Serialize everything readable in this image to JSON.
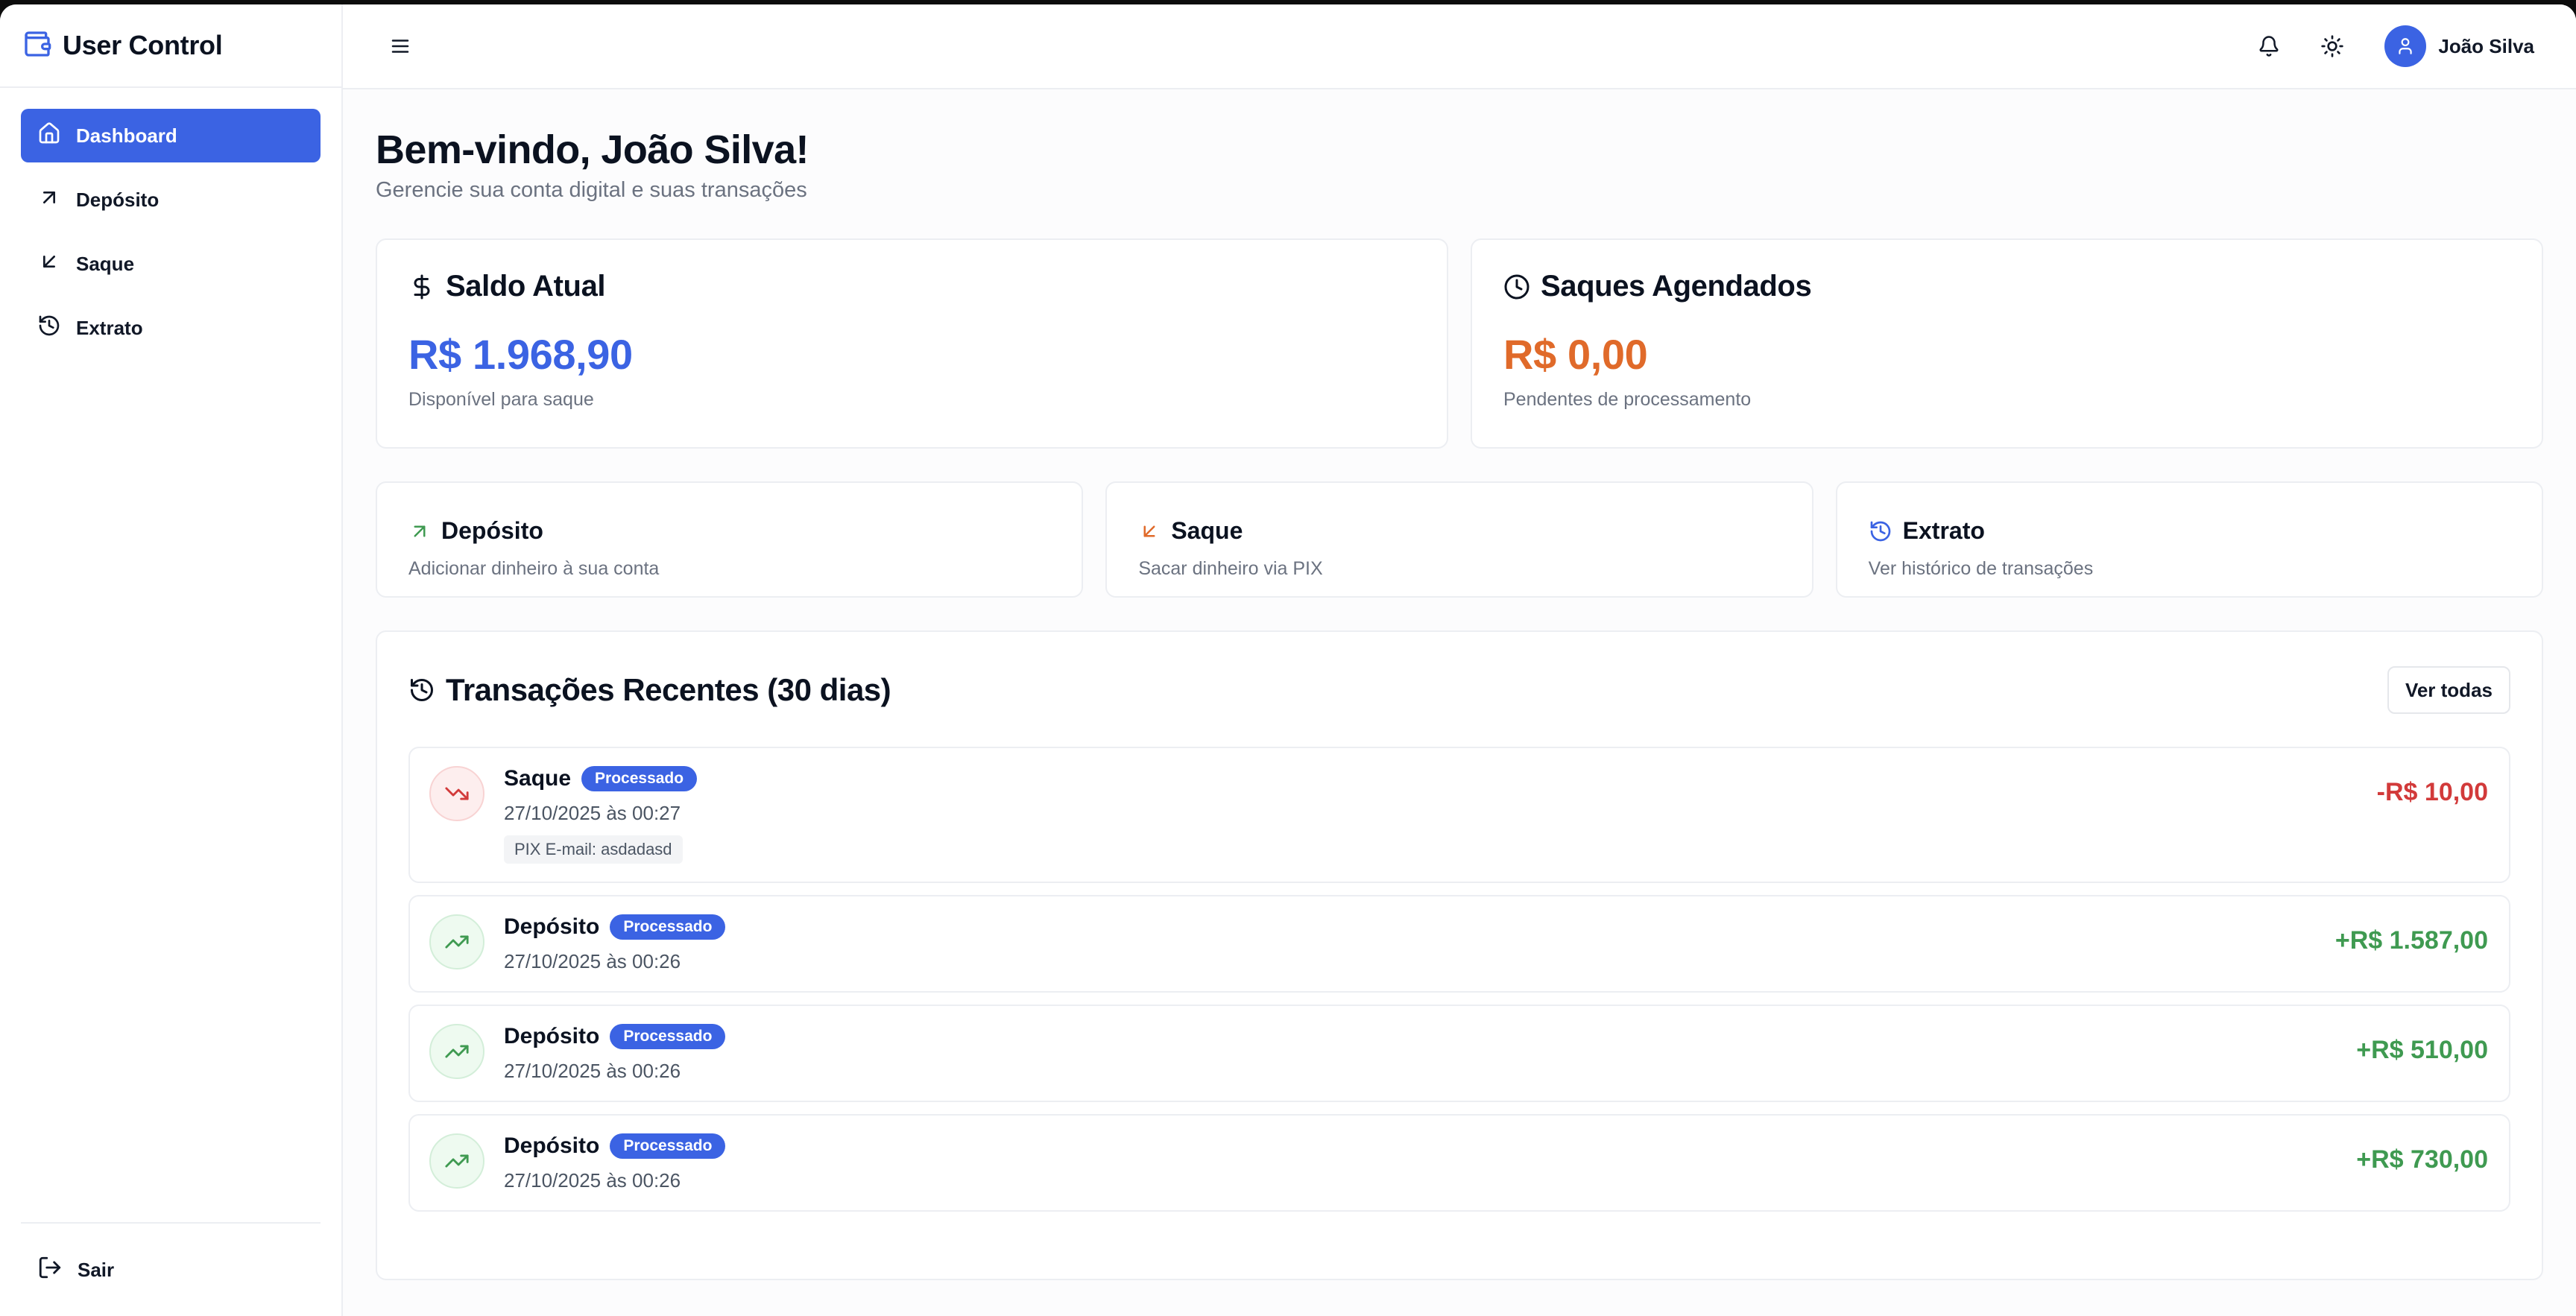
{
  "app": {
    "title": "User Control"
  },
  "sidebar": {
    "items": [
      {
        "label": "Dashboard",
        "icon": "home-icon",
        "active": true
      },
      {
        "label": "Depósito",
        "icon": "arrow-up-right-icon"
      },
      {
        "label": "Saque",
        "icon": "arrow-down-left-icon"
      },
      {
        "label": "Extrato",
        "icon": "history-icon"
      }
    ],
    "logout_label": "Sair"
  },
  "topbar": {
    "user_name": "João Silva"
  },
  "page": {
    "title": "Bem-vindo, João Silva!",
    "subtitle": "Gerencie sua conta digital e suas transações"
  },
  "balance": {
    "title": "Saldo Atual",
    "amount": "R$ 1.968,90",
    "note": "Disponível para saque"
  },
  "scheduled": {
    "title": "Saques Agendados",
    "amount": "R$ 0,00",
    "note": "Pendentes de processamento"
  },
  "actions": [
    {
      "title": "Depósito",
      "desc": "Adicionar dinheiro à sua conta"
    },
    {
      "title": "Saque",
      "desc": "Sacar dinheiro via PIX"
    },
    {
      "title": "Extrato",
      "desc": "Ver histórico de transações"
    }
  ],
  "recent": {
    "title": "Transações Recentes (30 dias)",
    "view_all": "Ver todas",
    "transactions": [
      {
        "type": "Saque",
        "status": "Processado",
        "date": "27/10/2025 às 00:27",
        "meta": "PIX E-mail: asdadasd",
        "amount": "-R$ 10,00"
      },
      {
        "type": "Depósito",
        "status": "Processado",
        "date": "27/10/2025 às 00:26",
        "amount": "+R$ 1.587,00"
      },
      {
        "type": "Depósito",
        "status": "Processado",
        "date": "27/10/2025 às 00:26",
        "amount": "+R$ 510,00"
      },
      {
        "type": "Depósito",
        "status": "Processado",
        "date": "27/10/2025 às 00:26",
        "amount": "+R$ 730,00"
      }
    ]
  },
  "colors": {
    "accent": "#3b63e3",
    "orange": "#e06a2a",
    "negative": "#d23a3a",
    "positive": "#3f9a51"
  }
}
